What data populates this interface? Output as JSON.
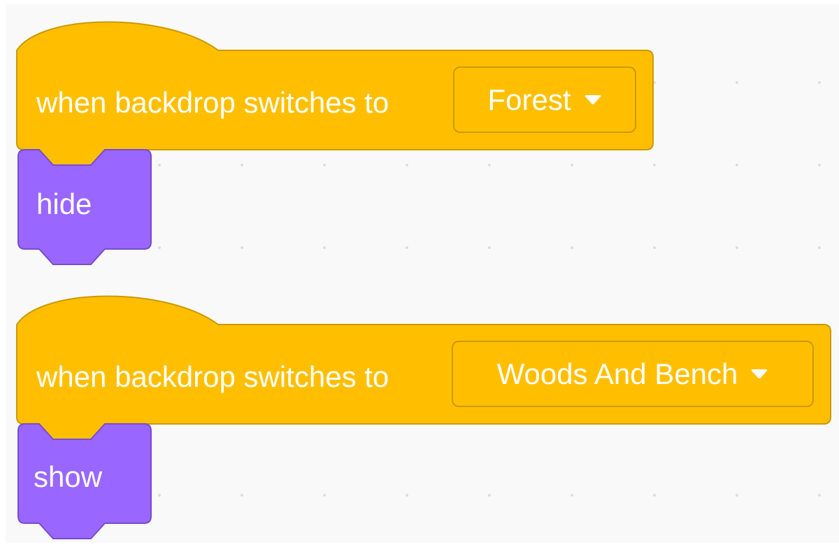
{
  "workspace": {
    "background": "#f9f9f9",
    "grid_dot_color": "#dddddd"
  },
  "colors": {
    "events": "#ffbf00",
    "events_border": "#cc9900",
    "looks": "#9966ff",
    "looks_border": "#774dcb",
    "text": "#ffffff"
  },
  "scripts": [
    {
      "hat": {
        "label": "when backdrop switches to",
        "dropdown_value": "Forest",
        "dropdown_icon": "caret-down-icon"
      },
      "block": {
        "label": "hide"
      }
    },
    {
      "hat": {
        "label": "when backdrop switches to",
        "dropdown_value": "Woods And Bench",
        "dropdown_icon": "caret-down-icon"
      },
      "block": {
        "label": "show"
      }
    }
  ]
}
